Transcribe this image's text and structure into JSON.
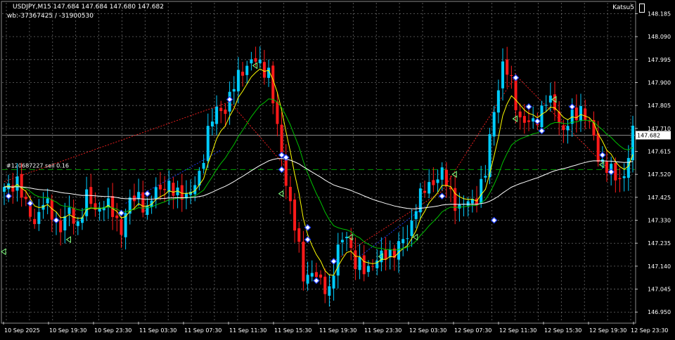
{
  "header": {
    "symbol_line": "USDJPY,M15  147.684 147.684 147.680 147.682",
    "info_line": "wb:-37367425 / -31900530",
    "ea_name": "Katsu5"
  },
  "order_label": "#120687227 sell 0.16",
  "current_price": "147.682",
  "colors": {
    "background": "#000000",
    "grid": "#c0c0c0",
    "bull": "#00ccff",
    "bear": "#ff1a1a",
    "ma_fast": "#ffff00",
    "ma_mid": "#00c000",
    "ma_slow": "#ffffff",
    "order_line": "#00a000",
    "trade_line_buy": "#ff2020",
    "trade_line_sell": "#2040ff"
  },
  "chart_data": {
    "type": "candlestick",
    "symbol": "USDJPY",
    "timeframe": "M15",
    "ylim": [
      146.91,
      148.23
    ],
    "y_ticks": [
      "148.185",
      "148.090",
      "147.995",
      "147.900",
      "147.805",
      "147.710",
      "147.615",
      "147.520",
      "147.425",
      "147.330",
      "147.235",
      "147.140",
      "147.045",
      "146.950"
    ],
    "x_ticks": [
      "10 Sep 2025",
      "10 Sep 19:30",
      "10 Sep 23:30",
      "11 Sep 03:30",
      "11 Sep 07:30",
      "11 Sep 11:30",
      "11 Sep 15:30",
      "11 Sep 19:30",
      "11 Sep 23:30",
      "12 Sep 03:30",
      "12 Sep 07:30",
      "12 Sep 11:30",
      "12 Sep 15:30",
      "12 Sep 19:30",
      "12 Sep 23:30"
    ],
    "order_price": 147.54,
    "current_price": 147.682,
    "close_path": [
      [
        0,
        147.45
      ],
      [
        3,
        147.5
      ],
      [
        5,
        147.38
      ],
      [
        7,
        147.33
      ],
      [
        9,
        147.4
      ],
      [
        11,
        147.36
      ],
      [
        13,
        147.3
      ],
      [
        15,
        147.36
      ],
      [
        17,
        147.32
      ],
      [
        19,
        147.42
      ],
      [
        21,
        147.38
      ],
      [
        23,
        147.4
      ],
      [
        25,
        147.36
      ],
      [
        27,
        147.3
      ],
      [
        29,
        147.4
      ],
      [
        31,
        147.44
      ],
      [
        33,
        147.36
      ],
      [
        35,
        147.46
      ],
      [
        37,
        147.48
      ],
      [
        39,
        147.44
      ],
      [
        41,
        147.45
      ],
      [
        43,
        147.43
      ],
      [
        45,
        147.52
      ],
      [
        47,
        147.7
      ],
      [
        49,
        147.78
      ],
      [
        51,
        147.8
      ],
      [
        53,
        147.88
      ],
      [
        55,
        147.96
      ],
      [
        57,
        147.99
      ],
      [
        59,
        147.97
      ],
      [
        61,
        147.95
      ],
      [
        63,
        147.7
      ],
      [
        65,
        147.5
      ],
      [
        67,
        147.3
      ],
      [
        69,
        147.1
      ],
      [
        71,
        147.12
      ],
      [
        73,
        147.06
      ],
      [
        75,
        147.05
      ],
      [
        77,
        147.2
      ],
      [
        79,
        147.28
      ],
      [
        81,
        147.15
      ],
      [
        83,
        147.12
      ],
      [
        85,
        147.16
      ],
      [
        87,
        147.17
      ],
      [
        89,
        147.2
      ],
      [
        91,
        147.22
      ],
      [
        93,
        147.26
      ],
      [
        95,
        147.4
      ],
      [
        97,
        147.45
      ],
      [
        99,
        147.5
      ],
      [
        101,
        147.52
      ],
      [
        103,
        147.44
      ],
      [
        105,
        147.38
      ],
      [
        107,
        147.4
      ],
      [
        109,
        147.43
      ],
      [
        111,
        147.52
      ],
      [
        113,
        147.8
      ],
      [
        115,
        147.97
      ],
      [
        117,
        147.9
      ],
      [
        119,
        147.75
      ],
      [
        121,
        147.72
      ],
      [
        123,
        147.76
      ],
      [
        125,
        147.82
      ],
      [
        127,
        147.8
      ],
      [
        129,
        147.7
      ],
      [
        131,
        147.75
      ],
      [
        133,
        147.8
      ],
      [
        135,
        147.72
      ],
      [
        137,
        147.6
      ],
      [
        139,
        147.55
      ],
      [
        141,
        147.5
      ],
      [
        143,
        147.52
      ],
      [
        145,
        147.68
      ]
    ],
    "markers": {
      "diamonds": [
        [
          1,
          147.43
        ],
        [
          6,
          147.4
        ],
        [
          12,
          147.33
        ],
        [
          27,
          147.36
        ],
        [
          33,
          147.44
        ],
        [
          52,
          147.83
        ],
        [
          64,
          147.6
        ],
        [
          65,
          147.59
        ],
        [
          64,
          147.54
        ],
        [
          70,
          147.3
        ],
        [
          70,
          147.25
        ],
        [
          72,
          147.08
        ],
        [
          76,
          147.16
        ],
        [
          101,
          147.43
        ],
        [
          113,
          147.33
        ],
        [
          118,
          147.92
        ],
        [
          121,
          147.8
        ],
        [
          123,
          147.74
        ],
        [
          124,
          147.7
        ],
        [
          131,
          147.8
        ],
        [
          138,
          147.6
        ],
        [
          140,
          147.53
        ]
      ],
      "arrows_left": [
        [
          0,
          147.2
        ],
        [
          15,
          147.25
        ],
        [
          58,
          147.97
        ],
        [
          64,
          147.44
        ],
        [
          80,
          147.26
        ],
        [
          87,
          147.18
        ],
        [
          95,
          147.26
        ],
        [
          104,
          147.52
        ],
        [
          118,
          147.75
        ],
        [
          127,
          147.83
        ],
        [
          138,
          147.56
        ]
      ]
    }
  }
}
